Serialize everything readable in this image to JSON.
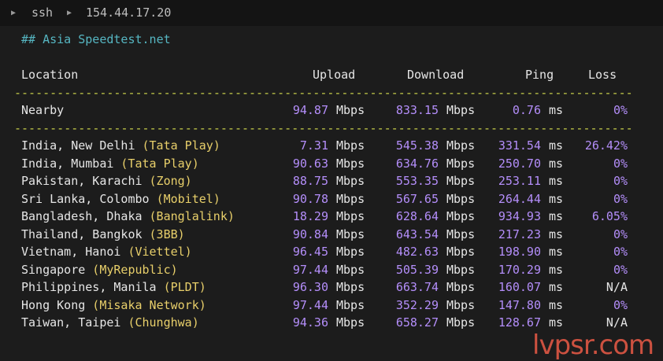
{
  "tabs": [
    {
      "label": "ssh",
      "icon": "triangle-right-icon"
    },
    {
      "label": "154.44.17.20",
      "icon": "triangle-right-icon"
    }
  ],
  "terminal": {
    "heading": "## Asia Speedtest.net",
    "headers": {
      "location": "Location",
      "upload": "Upload",
      "download": "Download",
      "ping": "Ping",
      "loss": "Loss"
    },
    "separator": "-------------------------------------------------------------------------------------------------",
    "nearby": {
      "location": "Nearby",
      "upload": "94.87",
      "download": "833.15",
      "ping": "0.76",
      "loss": "0%"
    },
    "unit_speed": "Mbps",
    "unit_ping": "ms",
    "rows": [
      {
        "location": "India, New Delhi",
        "isp": "(Tata Play)",
        "upload": "7.31",
        "download": "545.38",
        "ping": "331.54",
        "loss": "26.42%"
      },
      {
        "location": "India, Mumbai",
        "isp": "(Tata Play)",
        "upload": "90.63",
        "download": "634.76",
        "ping": "250.70",
        "loss": "0%"
      },
      {
        "location": "Pakistan, Karachi",
        "isp": "(Zong)",
        "upload": "88.75",
        "download": "553.35",
        "ping": "253.11",
        "loss": "0%"
      },
      {
        "location": "Sri Lanka, Colombo",
        "isp": "(Mobitel)",
        "upload": "90.78",
        "download": "567.65",
        "ping": "264.44",
        "loss": "0%"
      },
      {
        "location": "Bangladesh, Dhaka",
        "isp": "(Banglalink)",
        "upload": "18.29",
        "download": "628.64",
        "ping": "934.93",
        "loss": "6.05%"
      },
      {
        "location": "Thailand, Bangkok",
        "isp": "(3BB)",
        "upload": "90.84",
        "download": "643.54",
        "ping": "217.23",
        "loss": "0%"
      },
      {
        "location": "Vietnam, Hanoi",
        "isp": "(Viettel)",
        "upload": "96.45",
        "download": "482.63",
        "ping": "198.90",
        "loss": "0%"
      },
      {
        "location": "Singapore",
        "isp": "(MyRepublic)",
        "upload": "97.44",
        "download": "505.39",
        "ping": "170.29",
        "loss": "0%"
      },
      {
        "location": "Philippines, Manila",
        "isp": "(PLDT)",
        "upload": "96.30",
        "download": "663.74",
        "ping": "160.07",
        "loss": "N/A"
      },
      {
        "location": "Hong Kong",
        "isp": "(Misaka Network)",
        "upload": "97.44",
        "download": "352.29",
        "ping": "147.80",
        "loss": "0%"
      },
      {
        "location": "Taiwan, Taipei",
        "isp": "(Chunghwa)",
        "upload": "94.36",
        "download": "658.27",
        "ping": "128.67",
        "loss": "N/A"
      }
    ]
  },
  "watermark": "lvpsr.com",
  "colors": {
    "background": "#1c1c1c",
    "heading": "#56b6c2",
    "number": "#b48efa",
    "isp": "#e8cf6a",
    "separator": "#c8cf4a"
  }
}
